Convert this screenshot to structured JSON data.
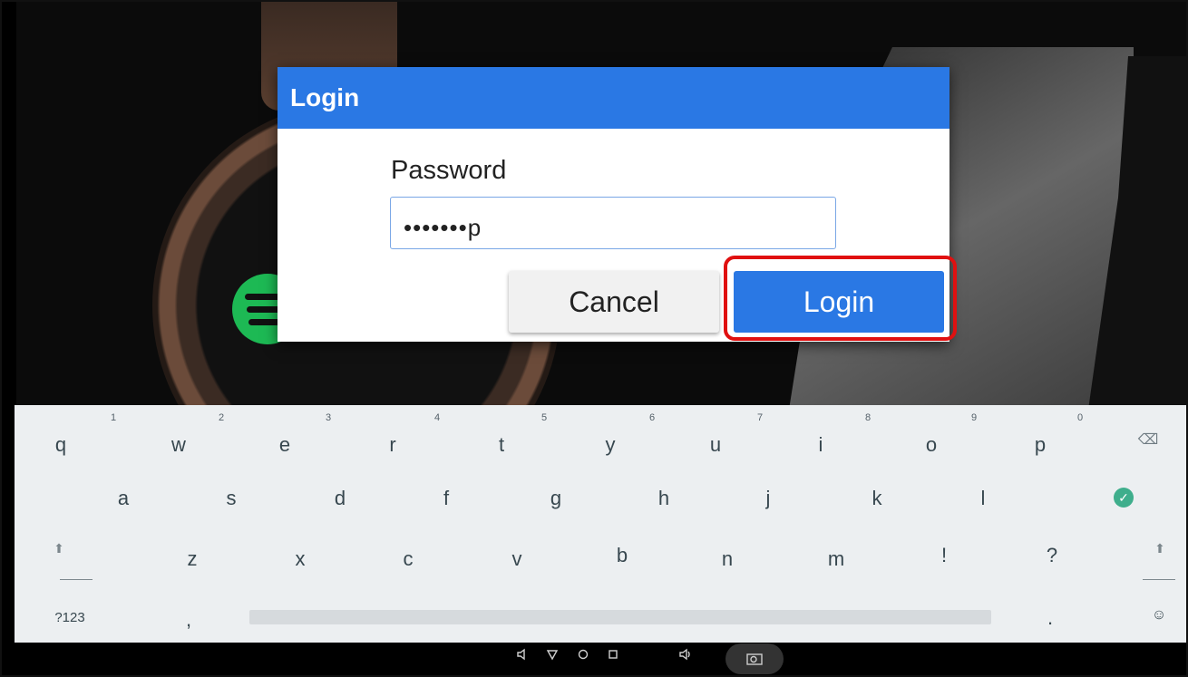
{
  "dialog": {
    "title": "Login",
    "password_label": "Password",
    "password_value": "•••••••p",
    "cancel_label": "Cancel",
    "login_label": "Login"
  },
  "keyboard": {
    "row1": [
      {
        "key": "q",
        "hint": "1"
      },
      {
        "key": "w",
        "hint": "2"
      },
      {
        "key": "e",
        "hint": "3"
      },
      {
        "key": "r",
        "hint": "4"
      },
      {
        "key": "t",
        "hint": "5"
      },
      {
        "key": "y",
        "hint": "6"
      },
      {
        "key": "u",
        "hint": "7"
      },
      {
        "key": "i",
        "hint": "8"
      },
      {
        "key": "o",
        "hint": "9"
      },
      {
        "key": "p",
        "hint": "0"
      }
    ],
    "row2": [
      "a",
      "s",
      "d",
      "f",
      "g",
      "h",
      "j",
      "k",
      "l"
    ],
    "row3": [
      "z",
      "x",
      "c",
      "v",
      "b",
      "n",
      "m",
      "!",
      "?"
    ],
    "symbols_label": "?123",
    "comma": ",",
    "period": ".",
    "backspace_icon": "⌫",
    "done_icon": "✓",
    "shift_icon": "⬆",
    "emoji_icon": "☺"
  },
  "navbar": {
    "icons": [
      "volume-down-icon",
      "back-icon",
      "home-icon",
      "recents-icon",
      "volume-up-icon",
      "screenshot-icon"
    ]
  },
  "colors": {
    "accent": "#2a78e4",
    "highlight": "#e01010",
    "keyboard_bg": "#eceff1"
  }
}
